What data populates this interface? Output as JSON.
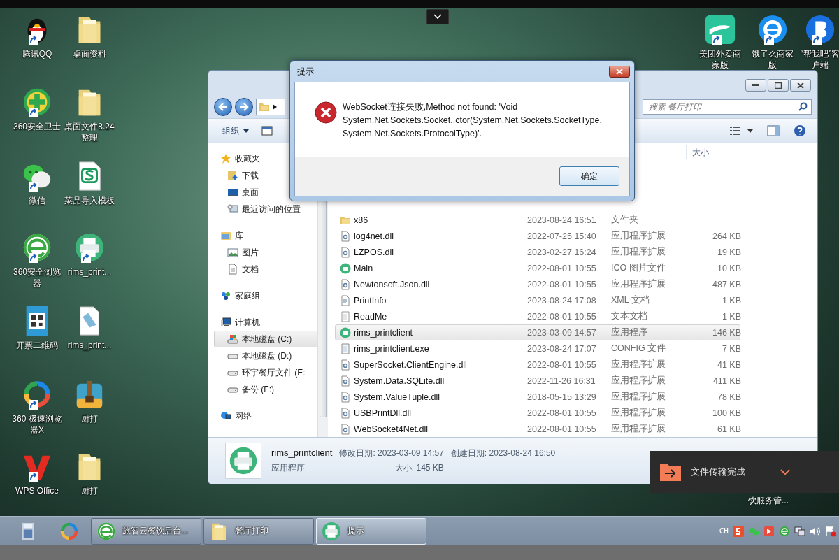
{
  "desktop_icons": [
    {
      "label": "腾讯QQ",
      "kind": "penguin"
    },
    {
      "label": "桌面资料",
      "kind": "folder"
    },
    {
      "label": "360安全卫士",
      "kind": "shield"
    },
    {
      "label": "桌面文件8.24整理",
      "kind": "folder"
    },
    {
      "label": "微信",
      "kind": "chat"
    },
    {
      "label": "菜品导入模板",
      "kind": "sheet"
    },
    {
      "label": "360安全浏览器",
      "kind": "browser"
    },
    {
      "label": "rims_print...",
      "kind": "printer"
    },
    {
      "label": "开票二维码",
      "kind": "qrcode"
    },
    {
      "label": "rims_print...",
      "kind": "document"
    },
    {
      "label": "360 极速浏览器X",
      "kind": "ring"
    },
    {
      "label": "厨打",
      "kind": "bag"
    },
    {
      "label": "WPS Office",
      "kind": "wps"
    },
    {
      "label": "厨打",
      "kind": "folder"
    },
    {
      "label": "美团外卖商家版",
      "kind": "delivery"
    },
    {
      "label": "饿了么商家版",
      "kind": "eleme"
    },
    {
      "label": "“帮我吧”客户端",
      "kind": "helper"
    }
  ],
  "covered_icon_label": "饮服务管...",
  "explorer": {
    "search": {
      "placeholder": "搜索 餐厅打印"
    },
    "toolbar": {
      "organize": "组织"
    },
    "nav": [
      {
        "label": "收藏夹",
        "kind": "star",
        "selected": false,
        "children": [
          {
            "label": "下载",
            "kind": "download",
            "selected": false
          },
          {
            "label": "桌面",
            "kind": "desktop",
            "selected": false
          },
          {
            "label": "最近访问的位置",
            "kind": "recent",
            "selected": false
          }
        ]
      },
      {
        "label": "库",
        "kind": "library",
        "selected": false,
        "children": [
          {
            "label": "图片",
            "kind": "picture",
            "selected": false
          },
          {
            "label": "文档",
            "kind": "doc",
            "selected": false
          }
        ]
      },
      {
        "label": "家庭组",
        "kind": "homegroup",
        "selected": false
      },
      {
        "label": "计算机",
        "kind": "computer",
        "selected": false,
        "children": [
          {
            "label": "本地磁盘 (C:)",
            "kind": "systemdrive",
            "selected": true
          },
          {
            "label": "本地磁盘 (D:)",
            "kind": "drive",
            "selected": false
          },
          {
            "label": "环宇餐厅文件 (E:",
            "kind": "drive",
            "selected": false
          },
          {
            "label": "备份 (F:)",
            "kind": "drive",
            "selected": false
          }
        ]
      },
      {
        "label": "网络",
        "kind": "network",
        "selected": false
      }
    ],
    "size_column_header": "大小",
    "files": [
      {
        "name": "x86",
        "modified": "2023-08-24 16:51",
        "type": "文件夹",
        "kind": "folder",
        "selected": false
      },
      {
        "name": "log4net.dll",
        "modified": "2022-07-25 15:40",
        "type": "应用程序扩展",
        "size": "264 KB",
        "kind": "dll",
        "selected": false
      },
      {
        "name": "LZPOS.dll",
        "modified": "2023-02-27 16:24",
        "type": "应用程序扩展",
        "size": "19 KB",
        "kind": "dll",
        "selected": false
      },
      {
        "name": "Main",
        "modified": "2022-08-01 10:55",
        "type": "ICO 图片文件",
        "size": "10 KB",
        "kind": "app",
        "selected": false
      },
      {
        "name": "Newtonsoft.Json.dll",
        "modified": "2022-08-01 10:55",
        "type": "应用程序扩展",
        "size": "487 KB",
        "kind": "dll",
        "selected": false
      },
      {
        "name": "PrintInfo",
        "modified": "2023-08-24 17:08",
        "type": "XML 文档",
        "size": "1 KB",
        "kind": "xml",
        "selected": false
      },
      {
        "name": "ReadMe",
        "modified": "2022-08-01 10:55",
        "type": "文本文档",
        "size": "1 KB",
        "kind": "text",
        "selected": false
      },
      {
        "name": "rims_printclient",
        "modified": "2023-03-09 14:57",
        "type": "应用程序",
        "size": "146 KB",
        "kind": "app",
        "selected": true
      },
      {
        "name": "rims_printclient.exe",
        "modified": "2023-08-24 17:07",
        "type": "CONFIG 文件",
        "size": "7 KB",
        "kind": "config",
        "selected": false
      },
      {
        "name": "SuperSocket.ClientEngine.dll",
        "modified": "2022-08-01 10:55",
        "type": "应用程序扩展",
        "size": "41 KB",
        "kind": "dll",
        "selected": false
      },
      {
        "name": "System.Data.SQLite.dll",
        "modified": "2022-11-26 16:31",
        "type": "应用程序扩展",
        "size": "411 KB",
        "kind": "dll",
        "selected": false
      },
      {
        "name": "System.ValueTuple.dll",
        "modified": "2018-05-15 13:29",
        "type": "应用程序扩展",
        "size": "78 KB",
        "kind": "dll",
        "selected": false
      },
      {
        "name": "USBPrintDll.dll",
        "modified": "2022-08-01 10:55",
        "type": "应用程序扩展",
        "size": "100 KB",
        "kind": "dll",
        "selected": false
      },
      {
        "name": "WebSocket4Net.dll",
        "modified": "2022-08-01 10:55",
        "type": "应用程序扩展",
        "size": "61 KB",
        "kind": "dll",
        "selected": false
      }
    ],
    "details": {
      "name": "rims_printclient",
      "type": "应用程序",
      "modified": "修改日期: 2023-03-09 14:57",
      "size": "大小: 145 KB",
      "created": "创建日期: 2023-08-24 16:50"
    }
  },
  "dialog": {
    "title": "提示",
    "message": "WebSocket连接失败,Method not found: 'Void System.Net.Sockets.Socket..ctor(System.Net.Sockets.SocketType, System.Net.Sockets.ProtocolType)'.",
    "button": "确定"
  },
  "toast": {
    "text": "文件传输完成"
  },
  "taskbar": {
    "pinned": [
      {
        "kind": "calculator"
      },
      {
        "kind": "ring"
      }
    ],
    "buttons": [
      {
        "label": "旅智云餐饮后台...",
        "kind": "browser",
        "selected": false
      },
      {
        "label": "餐厅打印",
        "kind": "folder",
        "selected": false
      },
      {
        "label": "提示",
        "kind": "printer",
        "selected": true
      }
    ],
    "tray": {
      "language": "CH"
    }
  }
}
